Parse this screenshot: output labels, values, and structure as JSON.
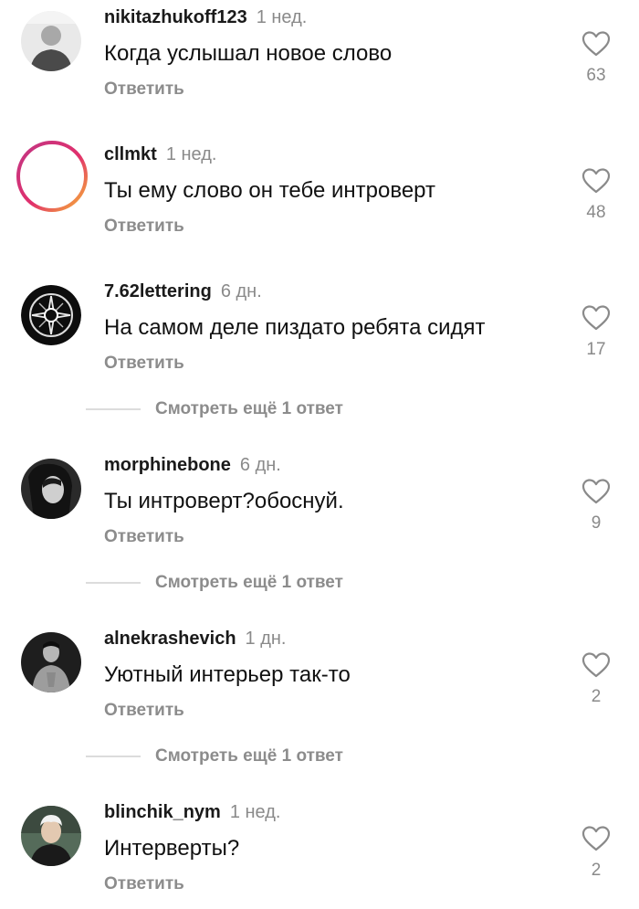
{
  "ui": {
    "reply_label": "Ответить",
    "more_replies_label": "Смотреть ещё 1 ответ"
  },
  "comments": [
    {
      "username": "nikitazhukoff123",
      "time": "1 нед.",
      "text": "Когда услышал новое слово",
      "likes": "63",
      "avatar": "photo-person-icon"
    },
    {
      "username": "cllmkt",
      "time": "1 нед.",
      "text": "Ты ему слово он тебе интроверт",
      "likes": "48",
      "avatar": "story-ring-avatar"
    },
    {
      "username": "7.62lettering",
      "time": "6 дн.",
      "text": "На самом деле пиздато ребята сидят",
      "likes": "17",
      "avatar": "logo-avatar"
    },
    {
      "username": "morphinebone",
      "time": "6 дн.",
      "text": "Ты интроверт?обоснуй.",
      "likes": "9",
      "avatar": "photo-person-icon"
    },
    {
      "username": "alnekrashevich",
      "time": "1 дн.",
      "text": "Уютный интерьер так-то",
      "likes": "2",
      "avatar": "photo-person-icon"
    },
    {
      "username": "blinchik_nym",
      "time": "1 нед.",
      "text": "Интерверты?",
      "likes": "2",
      "avatar": "photo-person-icon"
    }
  ],
  "colors": {
    "text": "#111111",
    "secondary": "#8a8a8a",
    "story_ring_start": "#c13584",
    "story_ring_end": "#f7b733"
  }
}
